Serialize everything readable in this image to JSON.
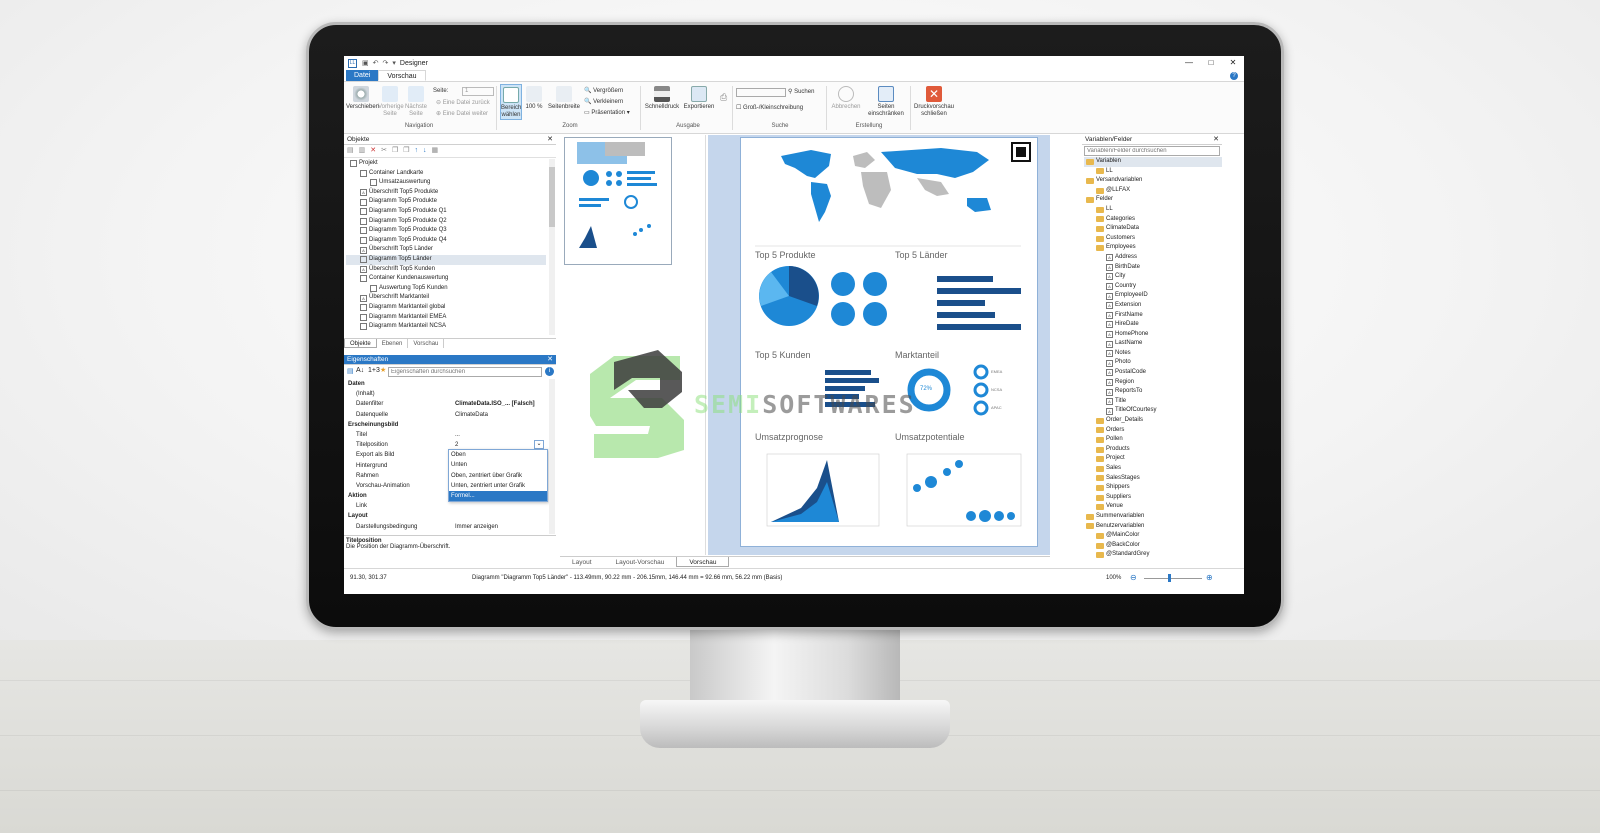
{
  "window": {
    "title": "Designer",
    "app_icon": "LL",
    "min": "—",
    "max": "□",
    "close": "✕"
  },
  "ribbon_tabs": [
    "Datei",
    "Vorschau"
  ],
  "ribbon": {
    "buttons": {
      "verschieben": "Verschieben",
      "vorherige": "Vorherige Seite",
      "naechste": "Nächste Seite",
      "seite_label": "Seite:",
      "seite_value": "1",
      "datei_zurueck": "Eine Datei zurück",
      "datei_weiter": "Eine Datei weiter",
      "bereich": "Bereich wählen",
      "zoom100": "100 %",
      "seitenbreite": "Seitenbreite",
      "vergroessern": "Vergrößern",
      "verkleinern": "Verkleinern",
      "praesentation": "Präsentation",
      "schnelldruck": "Schnelldruck",
      "exportieren": "Exportieren",
      "suchen": "Suchen",
      "gross_klein": "Groß-/Kleinschreibung",
      "abbrechen": "Abbrechen",
      "seiten_einschraenken": "Seiten einschränken",
      "druckvorschau_schliessen": "Druckvorschau schließen"
    },
    "groups": [
      "Navigation",
      "Zoom",
      "Ausgabe",
      "Suche",
      "Erstellung"
    ]
  },
  "objects_panel": {
    "title": "Objekte",
    "items": [
      {
        "label": "Projekt",
        "indent": 0
      },
      {
        "label": "Container Landkarte",
        "indent": 1
      },
      {
        "label": "Umsatzauswertung",
        "indent": 2
      },
      {
        "label": "Überschrift Top5 Produkte",
        "indent": 1
      },
      {
        "label": "Diagramm Top5 Produkte",
        "indent": 1
      },
      {
        "label": "Diagramm Top5 Produkte Q1",
        "indent": 1
      },
      {
        "label": "Diagramm Top5 Produkte Q2",
        "indent": 1
      },
      {
        "label": "Diagramm Top5 Produkte Q3",
        "indent": 1
      },
      {
        "label": "Diagramm Top5 Produkte Q4",
        "indent": 1
      },
      {
        "label": "Überschrift Top5 Länder",
        "indent": 1
      },
      {
        "label": "Diagramm Top5 Länder",
        "indent": 1,
        "selected": true
      },
      {
        "label": "Überschrift Top5 Kunden",
        "indent": 1
      },
      {
        "label": "Container Kundenauswertung",
        "indent": 1
      },
      {
        "label": "Auswertung Top5 Kunden",
        "indent": 2
      },
      {
        "label": "Überschrift Marktanteil",
        "indent": 1
      },
      {
        "label": "Diagramm Marktanteil global",
        "indent": 1
      },
      {
        "label": "Diagramm Marktanteil EMEA",
        "indent": 1
      },
      {
        "label": "Diagramm Marktanteil NCSA",
        "indent": 1
      }
    ],
    "tabs": [
      "Objekte",
      "Ebenen",
      "Vorschau"
    ]
  },
  "properties_panel": {
    "title": "Eigenschaften",
    "search_placeholder": "Eigenschaften durchsuchen",
    "rows": [
      {
        "k": "Daten",
        "v": "",
        "cat": true
      },
      {
        "k": "(Inhalt)",
        "v": ""
      },
      {
        "k": "Datenfilter",
        "v": "ClimateData.ISO_...  [Falsch]"
      },
      {
        "k": "Datenquelle",
        "v": "ClimateData"
      },
      {
        "k": "Erscheinungsbild",
        "v": "",
        "cat": true
      },
      {
        "k": "Titel",
        "v": "..."
      },
      {
        "k": "Titelposition",
        "v": "2"
      },
      {
        "k": "Export als Bild",
        "v": ""
      },
      {
        "k": "Hintergrund",
        "v": ""
      },
      {
        "k": "Rahmen",
        "v": ""
      },
      {
        "k": "Vorschau-Animation",
        "v": ""
      },
      {
        "k": "Aktion",
        "v": "",
        "cat": true
      },
      {
        "k": "Link",
        "v": ""
      },
      {
        "k": "Layout",
        "v": "",
        "cat": true
      },
      {
        "k": "Darstellungsbedingung",
        "v": "Immer anzeigen"
      }
    ],
    "dropdown_options": [
      "Oben",
      "Unten",
      "Oben, zentriert über Grafik",
      "Unten, zentriert unter Grafik",
      "Formel..."
    ],
    "help_title": "Titelposition",
    "help_text": "Die Position der Diagramm-Überschrift."
  },
  "report_page": {
    "sections": [
      "Top 5 Produkte",
      "Top 5 Länder",
      "Top 5 Kunden",
      "Marktanteil",
      "Umsatzprognose",
      "Umsatzpotentiale"
    ],
    "donut_label": "72%",
    "donut_legend": [
      "EMEA",
      "NCSA",
      "APAC"
    ]
  },
  "bottom_tabs": [
    "Layout",
    "Layout-Vorschau",
    "Vorschau"
  ],
  "variables_panel": {
    "title": "Variablen/Felder",
    "search_placeholder": "Variablen/Felder durchsuchen",
    "items": [
      {
        "label": "Variablen",
        "indent": 0,
        "type": "folder",
        "selected": true
      },
      {
        "label": "LL",
        "indent": 1,
        "type": "folder"
      },
      {
        "label": "Versandvariablen",
        "indent": 0,
        "type": "folder"
      },
      {
        "label": "@LLFAX",
        "indent": 1,
        "type": "folder"
      },
      {
        "label": "Felder",
        "indent": 0,
        "type": "folder"
      },
      {
        "label": "LL",
        "indent": 1,
        "type": "folder"
      },
      {
        "label": "Categories",
        "indent": 1,
        "type": "folder"
      },
      {
        "label": "ClimateData",
        "indent": 1,
        "type": "folder"
      },
      {
        "label": "Customers",
        "indent": 1,
        "type": "folder"
      },
      {
        "label": "Employees",
        "indent": 1,
        "type": "folder"
      },
      {
        "label": "Address",
        "indent": 2,
        "type": "field"
      },
      {
        "label": "BirthDate",
        "indent": 2,
        "type": "field"
      },
      {
        "label": "City",
        "indent": 2,
        "type": "field"
      },
      {
        "label": "Country",
        "indent": 2,
        "type": "field"
      },
      {
        "label": "EmployeeID",
        "indent": 2,
        "type": "field"
      },
      {
        "label": "Extension",
        "indent": 2,
        "type": "field"
      },
      {
        "label": "FirstName",
        "indent": 2,
        "type": "field"
      },
      {
        "label": "HireDate",
        "indent": 2,
        "type": "field"
      },
      {
        "label": "HomePhone",
        "indent": 2,
        "type": "field"
      },
      {
        "label": "LastName",
        "indent": 2,
        "type": "field"
      },
      {
        "label": "Notes",
        "indent": 2,
        "type": "field"
      },
      {
        "label": "Photo",
        "indent": 2,
        "type": "field"
      },
      {
        "label": "PostalCode",
        "indent": 2,
        "type": "field"
      },
      {
        "label": "Region",
        "indent": 2,
        "type": "field"
      },
      {
        "label": "ReportsTo",
        "indent": 2,
        "type": "field"
      },
      {
        "label": "Title",
        "indent": 2,
        "type": "field"
      },
      {
        "label": "TitleOfCourtesy",
        "indent": 2,
        "type": "field"
      },
      {
        "label": "Order_Details",
        "indent": 1,
        "type": "folder"
      },
      {
        "label": "Orders",
        "indent": 1,
        "type": "folder"
      },
      {
        "label": "Pollen",
        "indent": 1,
        "type": "folder"
      },
      {
        "label": "Products",
        "indent": 1,
        "type": "folder"
      },
      {
        "label": "Project",
        "indent": 1,
        "type": "folder"
      },
      {
        "label": "Sales",
        "indent": 1,
        "type": "folder"
      },
      {
        "label": "SalesStages",
        "indent": 1,
        "type": "folder"
      },
      {
        "label": "Shippers",
        "indent": 1,
        "type": "folder"
      },
      {
        "label": "Suppliers",
        "indent": 1,
        "type": "folder"
      },
      {
        "label": "Venue",
        "indent": 1,
        "type": "folder"
      },
      {
        "label": "Summenvariablen",
        "indent": 0,
        "type": "folder"
      },
      {
        "label": "Benutzervariablen",
        "indent": 0,
        "type": "folder"
      },
      {
        "label": "@MainColor",
        "indent": 1,
        "type": "folder"
      },
      {
        "label": "@BackColor",
        "indent": 1,
        "type": "folder"
      },
      {
        "label": "@StandardGrey",
        "indent": 1,
        "type": "folder"
      }
    ]
  },
  "status_bar": {
    "coords": "91.30, 301.37",
    "info": "Diagramm \"Diagramm Top5 Länder\" - 113.49mm, 90.22 mm - 206.15mm, 146.44 mm = 92.66 mm, 56.22 mm (Basis)",
    "zoom": "100%"
  },
  "watermark": {
    "text_a": "SEMI",
    "text_b": "SOFTWARES"
  },
  "colors": {
    "accent": "#2b78c5",
    "chart_blue": "#1e88d6",
    "dark_blue": "#1a4f8b",
    "light_blue": "#5bb7f0"
  }
}
